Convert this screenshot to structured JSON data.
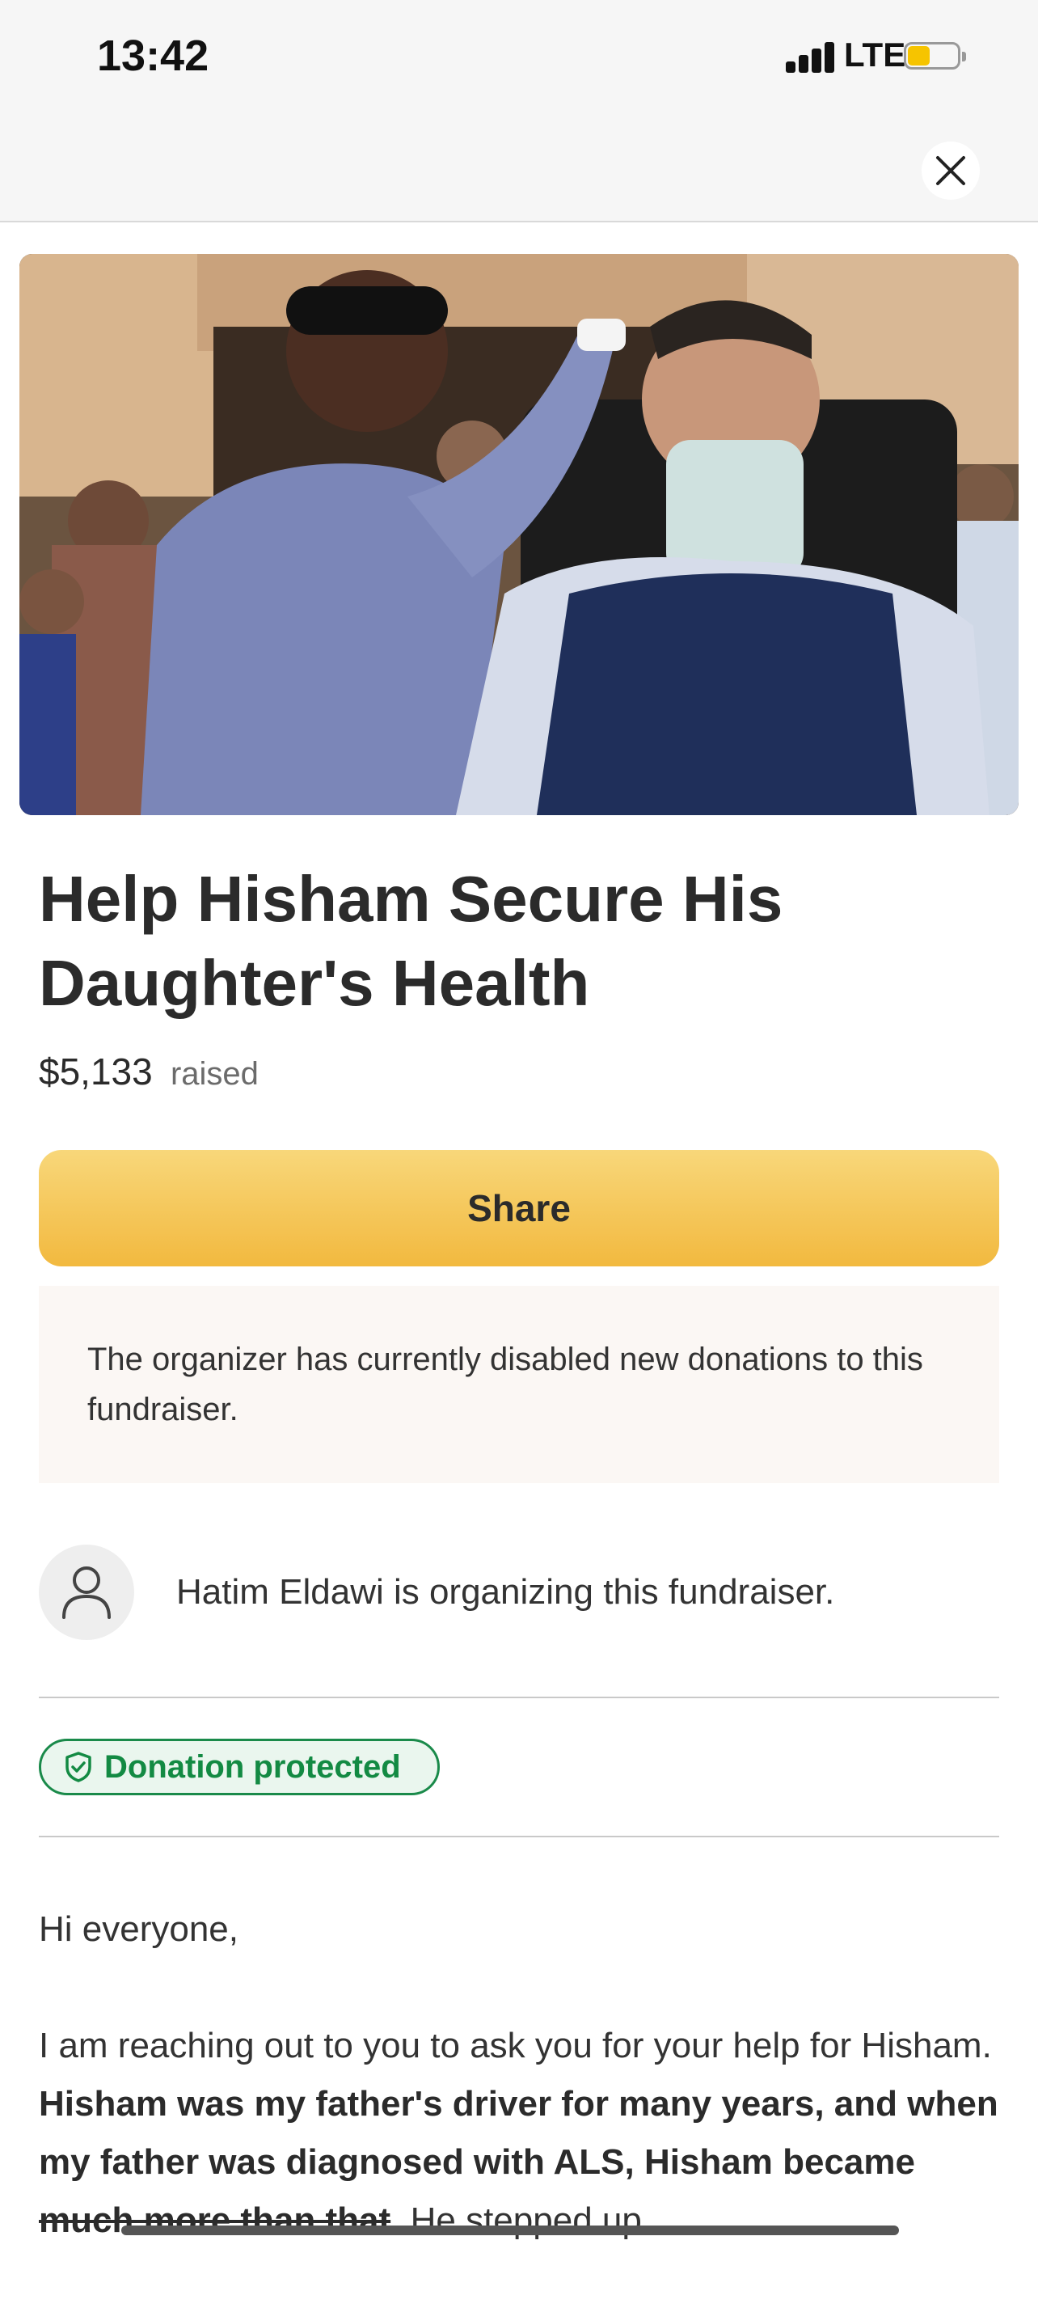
{
  "status_bar": {
    "time": "13:42",
    "network": "LTE",
    "battery_level_fraction": 0.45,
    "battery_color": "#f6c400"
  },
  "top_bar": {
    "close_icon": "close-icon"
  },
  "hero_image": {
    "kind": "photo",
    "colors": {
      "wall": "#c9a27c",
      "sweater": "#1f2f5a"
    }
  },
  "fundraiser": {
    "title": "Help Hisham Secure His Daughter's Health",
    "amount_raised": "$5,133",
    "raised_label": "raised",
    "share_label": "Share",
    "notice": "The organizer has currently disabled new donations to this fundraiser.",
    "organizer_text": "Hatim Eldawi is organizing this fundraiser.",
    "badge_label": "Donation protected",
    "badge_icon": "shield-check-icon",
    "avatar_icon": "user-icon"
  },
  "story": {
    "greeting": "Hi everyone,",
    "para_start": "I am reaching out to you to ask you for your help for Hisham. ",
    "para_bold_1": "Hisham was my father's driver for many years, and when my father was diagnosed with ALS, Hisham became ",
    "para_struck": "much more than that",
    "para_bold_end": ".",
    "para_after": " He stepped up"
  },
  "colors": {
    "accent_yellow": "#f2b93f",
    "badge_green": "#138a43",
    "notice_bg": "#fbf7f4"
  }
}
